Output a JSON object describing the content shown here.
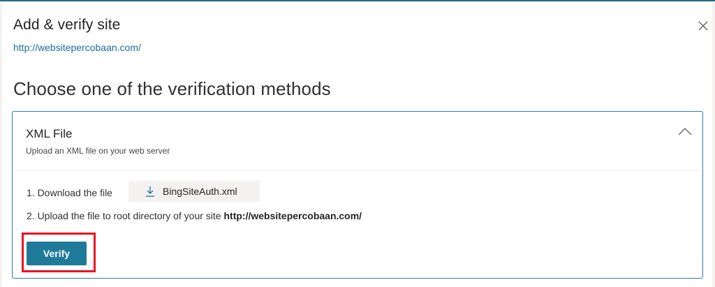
{
  "dialog": {
    "title": "Add & verify site",
    "site_url": "http://websitepercobaan.com/"
  },
  "section": {
    "heading": "Choose one of the verification methods"
  },
  "method": {
    "title": "XML File",
    "subtitle": "Upload an XML file on your web server",
    "step1_label": "1. Download the file",
    "download_filename": "BingSiteAuth.xml",
    "step2_prefix": "2. Upload the file to root directory of your site",
    "step2_url": "http://websitepercobaan.com/",
    "verify_label": "Verify"
  },
  "icons": {
    "close": "close-icon",
    "collapse": "chevron-up-icon",
    "download": "download-icon"
  },
  "colors": {
    "accent": "#1f7a99",
    "link": "#1b6f96",
    "card_border": "#2e7ea1",
    "highlight": "#e81123"
  }
}
